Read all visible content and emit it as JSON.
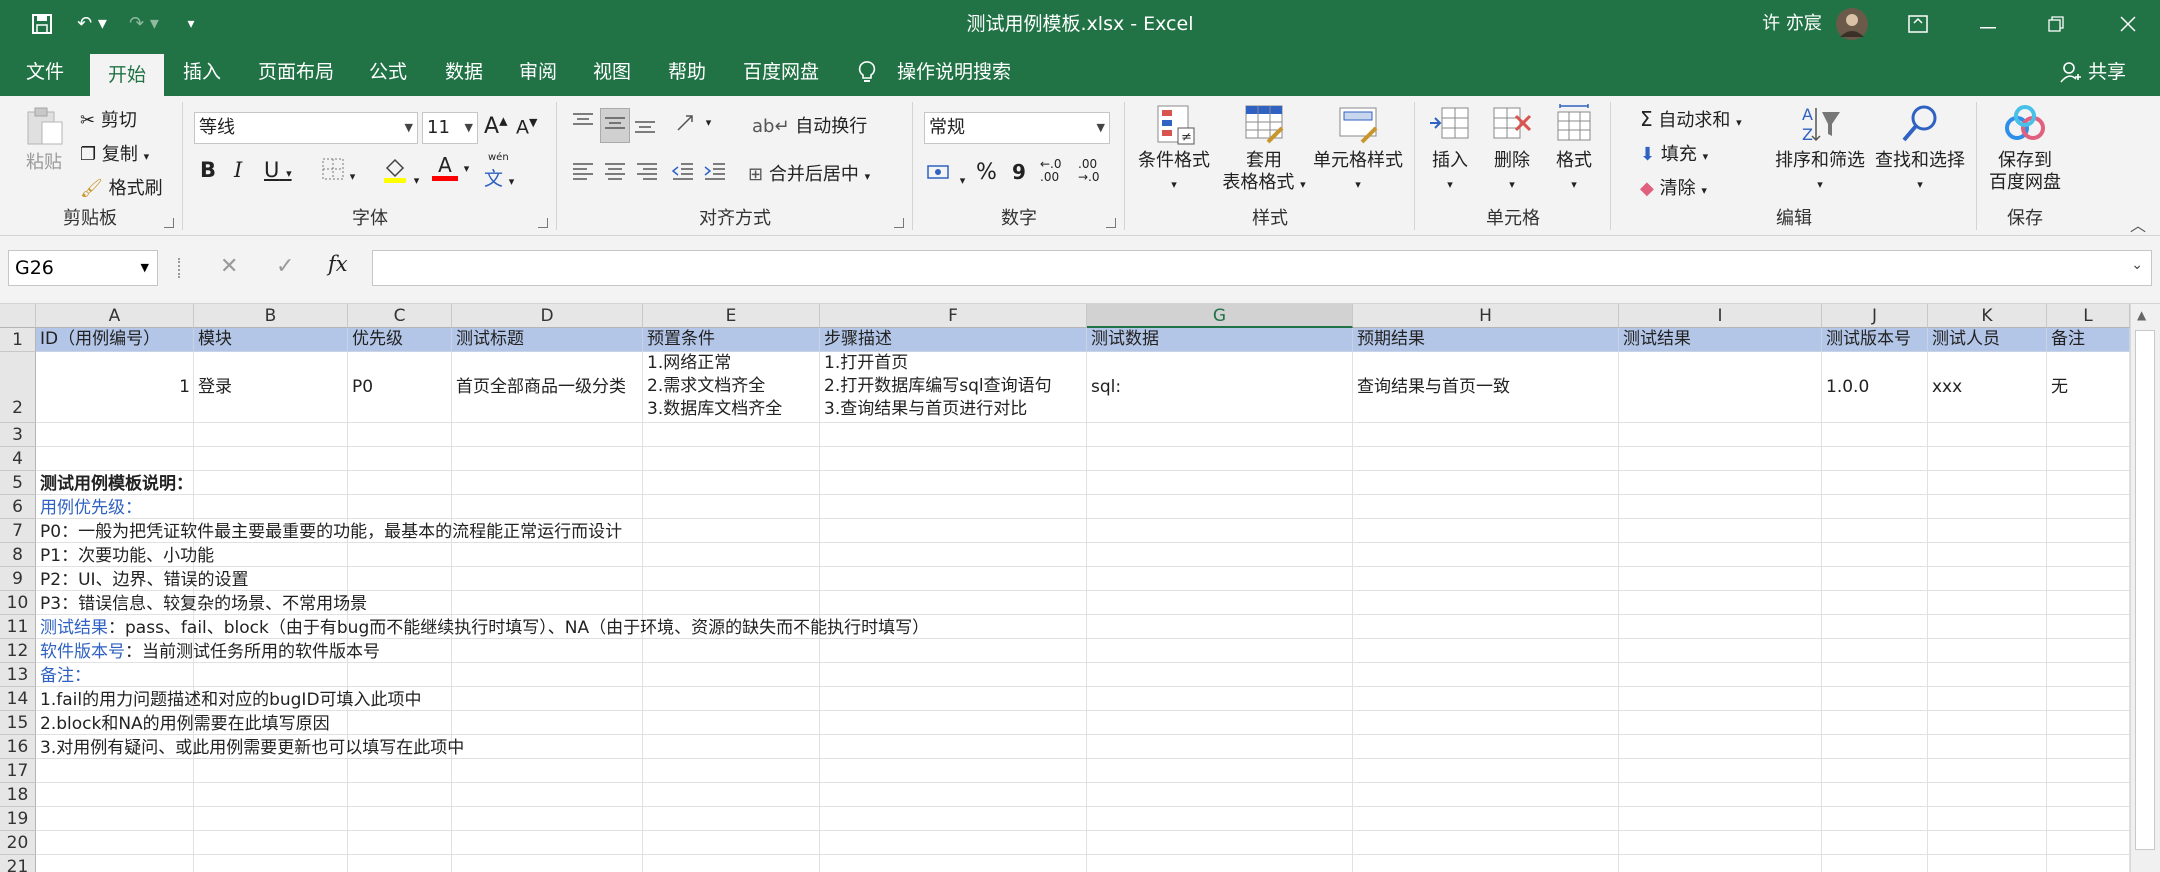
{
  "window": {
    "title": "测试用例模板.xlsx  -  Excel",
    "user": "许 亦宸",
    "share": "共享"
  },
  "tabs": [
    "文件",
    "开始",
    "插入",
    "页面布局",
    "公式",
    "数据",
    "审阅",
    "视图",
    "帮助",
    "百度网盘"
  ],
  "tell_me": "操作说明搜索",
  "clipboard": {
    "paste": "粘贴",
    "cut": "剪切",
    "copy": "复制",
    "painter": "格式刷",
    "label": "剪贴板"
  },
  "font": {
    "name": "等线",
    "size": "11",
    "label": "字体",
    "bold": "B",
    "italic": "I",
    "underline": "U",
    "color_a": "A",
    "grow": "A",
    "shrink": "A",
    "pinyin": "文"
  },
  "alignment": {
    "wrap": "自动换行",
    "merge": "合并后居中",
    "label": "对齐方式"
  },
  "number": {
    "format": "常规",
    "percent": "%",
    "comma": "9",
    "label": "数字"
  },
  "styles": {
    "cond": "条件格式",
    "table1": "套用",
    "table2": "表格格式",
    "cell": "单元格样式",
    "label": "样式"
  },
  "cells": {
    "insert": "插入",
    "delete": "删除",
    "format": "格式",
    "label": "单元格"
  },
  "editing": {
    "autosum": "自动求和",
    "fill": "填充",
    "clear": "清除",
    "sort": "排序和筛选",
    "find": "查找和选择",
    "label": "编辑"
  },
  "save": {
    "line1": "保存到",
    "line2": "百度网盘",
    "label": "保存"
  },
  "formula_bar": {
    "name_box": "G26",
    "fx": "fx",
    "value": ""
  },
  "columns": [
    "A",
    "B",
    "C",
    "D",
    "E",
    "F",
    "G",
    "H",
    "I",
    "J",
    "K",
    "L"
  ],
  "selected_column": "G",
  "rows": [
    "1",
    "2",
    "3",
    "4",
    "5",
    "6",
    "7",
    "8",
    "9",
    "10",
    "11",
    "12",
    "13",
    "14",
    "15",
    "16",
    "17",
    "18",
    "19",
    "20",
    "21"
  ],
  "header_row": [
    "ID（用例编号）",
    "模块",
    "优先级",
    "测试标题",
    "预置条件",
    "步骤描述",
    "测试数据",
    "预期结果",
    "测试结果",
    "测试版本号",
    "测试人员",
    "备注"
  ],
  "data_row": {
    "id": "1",
    "module": "登录",
    "priority": "P0",
    "title": "首页全部商品一级分类",
    "pre": [
      "1.网络正常",
      "2.需求文档齐全",
      "3.数据库文档齐全"
    ],
    "steps": [
      "1.打开首页",
      "2.打开数据库编写sql查询语句",
      "3.查询结果与首页进行对比"
    ],
    "data": "sql:",
    "expected": "查询结果与首页一致",
    "result": "",
    "version": "1.0.0",
    "tester": "xxx",
    "remark": "无"
  },
  "notes": {
    "r5": "测试用例模板说明：",
    "r6": "用例优先级：",
    "r7": "P0：一般为把凭证软件最主要最重要的功能，最基本的流程能正常运行而设计",
    "r8": "P1：次要功能、小功能",
    "r9": "P2：UI、边界、错误的设置",
    "r10": "P3：错误信息、较复杂的场景、不常用场景",
    "r11_label": "测试结果",
    "r11_text": "：pass、fail、block（由于有bug而不能继续执行时填写）、NA（由于环境、资源的缺失而不能执行时填写）",
    "r12_label": "软件版本号",
    "r12_text": "：当前测试任务所用的软件版本号",
    "r13": "备注：",
    "r14": "1.fail的用力问题描述和对应的bugID可填入此项中",
    "r15": "2.block和NA的用例需要在此填写原因",
    "r16": "3.对用例有疑问、或此用例需要更新也可以填写在此项中"
  }
}
